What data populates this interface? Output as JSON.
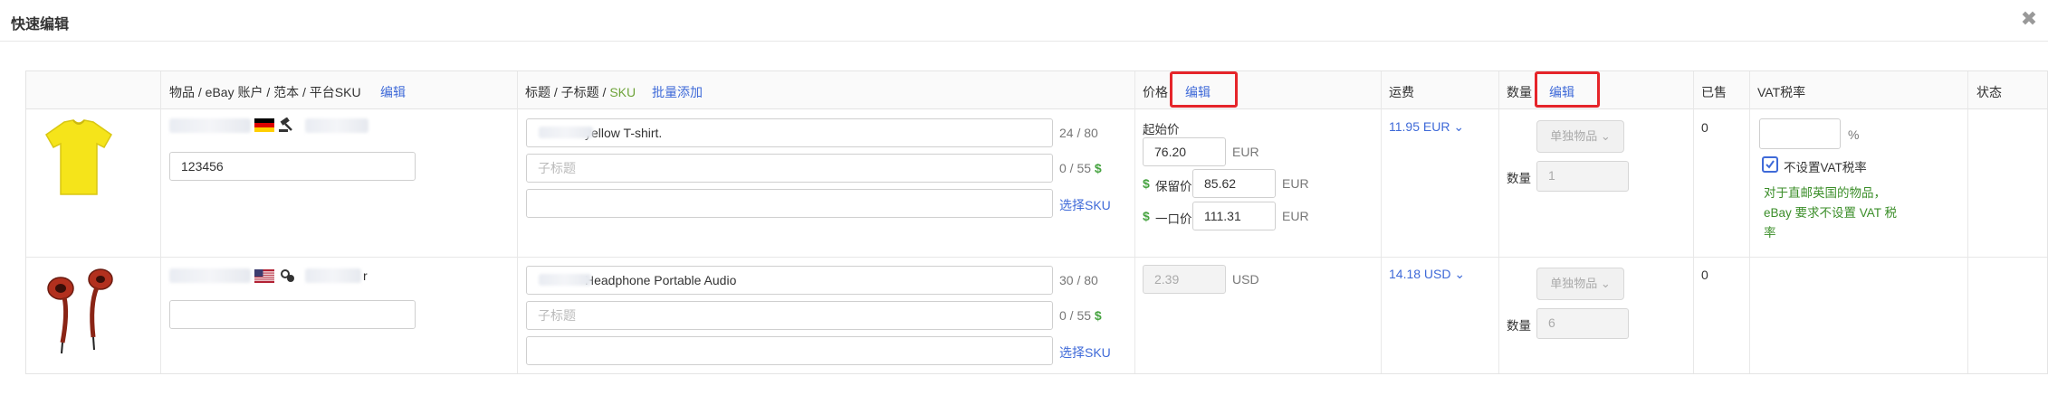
{
  "modal": {
    "title": "快速编辑",
    "close_glyph": "✖"
  },
  "columns": {
    "item": "物品 / eBay 账户 / 范本 / 平台SKU",
    "item_edit": "编辑",
    "title": "标题 / 子标题 / ",
    "title_sku": "SKU",
    "title_batch": "批量添加",
    "price": "价格",
    "price_edit": "编辑",
    "shipping": "运费",
    "quantity": "数量",
    "quantity_edit": "编辑",
    "sold": "已售",
    "vat": "VAT税率",
    "status": "状态"
  },
  "rows": [
    {
      "image": "yellow-tshirt",
      "flags": [
        "de-flag",
        "auction-icon"
      ],
      "sku": "123456",
      "title": "yellow T-shirt.",
      "title_counter": "24 / 80",
      "subtitle_placeholder": "子标题",
      "subtitle_counter": "0 / 55",
      "dollar": "$",
      "select_sku": "选择SKU",
      "start_price_label": "起始价",
      "start_price": "76.20",
      "currency": "EUR",
      "reserve_label": "保留价",
      "reserve_price": "85.62",
      "buynow_label": "一口价",
      "buynow_price": "111.31",
      "shipping": "11.95 EUR",
      "quantity_type": "单独物品",
      "quantity_label": "数量",
      "quantity_value": "1",
      "sold": "0",
      "vat_value": "",
      "vat_unit": "%",
      "vat_checkbox_label": "不设置VAT税率",
      "vat_checked": true,
      "vat_note": "对于直邮英国的物品，eBay 要求不设置 VAT 税率"
    },
    {
      "image": "red-earphones",
      "flags": [
        "us-flag",
        "fixed-price-icon"
      ],
      "sku": "",
      "title_suffix_r": "r",
      "title": "Headphone Portable Audio",
      "title_counter": "30 / 80",
      "subtitle_placeholder": "子标题",
      "subtitle_counter": "0 / 55",
      "dollar": "$",
      "select_sku": "选择SKU",
      "price": "2.39",
      "currency": "USD",
      "shipping": "14.18 USD",
      "quantity_type": "单独物品",
      "quantity_label": "数量",
      "quantity_value": "6",
      "sold": "0"
    }
  ],
  "colors": {
    "link": "#3f6ad8",
    "highlight": "#e5252a",
    "note": "#3b8e29",
    "dollar": "#46a340"
  }
}
